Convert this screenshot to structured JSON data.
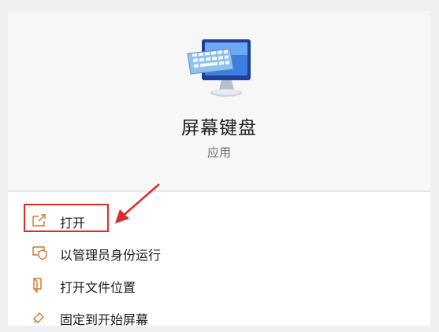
{
  "app": {
    "title": "屏幕键盘",
    "type": "应用",
    "icon": "onscreen-keyboard-icon"
  },
  "menu": [
    {
      "label": "打开",
      "icon": "open-icon"
    },
    {
      "label": "以管理员身份运行",
      "icon": "run-as-admin-icon"
    },
    {
      "label": "打开文件位置",
      "icon": "file-location-icon"
    },
    {
      "label": "固定到开始屏幕",
      "icon": "pin-icon"
    }
  ],
  "colors": {
    "icon_accent": "#d4742a",
    "highlight": "#e02a2a"
  }
}
